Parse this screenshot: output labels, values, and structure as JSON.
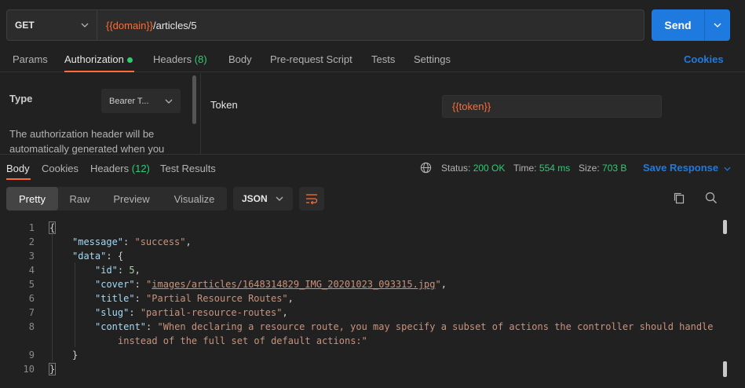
{
  "request": {
    "method": "GET",
    "url_var": "{{domain}}",
    "url_path": "/articles/5",
    "send_label": "Send"
  },
  "req_tabs": {
    "params": "Params",
    "authorization": "Authorization",
    "headers": "Headers",
    "headers_count": "(8)",
    "body": "Body",
    "prerequest": "Pre-request Script",
    "tests": "Tests",
    "settings": "Settings",
    "cookies": "Cookies"
  },
  "auth": {
    "type_label": "Type",
    "type_value": "Bearer T...",
    "description": "The authorization header will be automatically generated when you",
    "token_label": "Token",
    "token_value": "{{token}}"
  },
  "resp_tabs": {
    "body": "Body",
    "cookies": "Cookies",
    "headers": "Headers",
    "headers_count": "(12)",
    "test_results": "Test Results"
  },
  "status": {
    "status_label": "Status:",
    "status_value": "200 OK",
    "time_label": "Time:",
    "time_value": "554 ms",
    "size_label": "Size:",
    "size_value": "703 B",
    "save_response": "Save Response"
  },
  "view_modes": [
    "Pretty",
    "Raw",
    "Preview",
    "Visualize"
  ],
  "format": "JSON",
  "code": {
    "line_numbers": [
      "1",
      "2",
      "3",
      "4",
      "5",
      "6",
      "7",
      "8",
      "9",
      "10"
    ],
    "open_brace": "{",
    "close_brace": "}",
    "key_message": "\"message\"",
    "val_message": "\"success\"",
    "key_data": "\"data\"",
    "key_id": "\"id\"",
    "val_id": "5",
    "key_cover": "\"cover\"",
    "val_cover_open": "\"",
    "val_cover_link": "images/articles/1648314829_IMG_20201023_093315.jpg",
    "val_cover_close": "\"",
    "key_title": "\"title\"",
    "val_title": "\"Partial Resource Routes\"",
    "key_slug": "\"slug\"",
    "val_slug": "\"partial-resource-routes\"",
    "key_content": "\"content\"",
    "val_content_1": "\"When declaring a resource route, you may specify a subset of actions the controller should handle",
    "val_content_2": "instead of the full set of default actions:\""
  }
}
